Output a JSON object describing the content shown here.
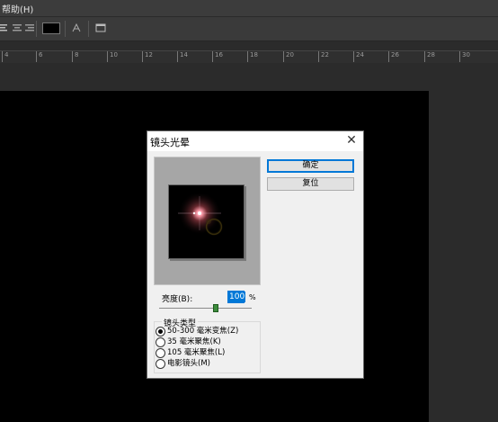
{
  "menu": {
    "help": "帮助(H)"
  },
  "toolbar": {
    "icons": [
      "align-left-icon",
      "align-center-icon",
      "align-right-icon",
      "color-swatch",
      "warp-text-icon",
      "panel-toggle-icon"
    ],
    "swatch_color": "#000000"
  },
  "ruler": {
    "labels": [
      "4",
      "6",
      "8",
      "10",
      "12",
      "14",
      "16",
      "18",
      "20",
      "22",
      "24",
      "26",
      "28",
      "30"
    ]
  },
  "dialog": {
    "title": "镜头光晕",
    "close_symbol": "✕",
    "ok_label": "确定",
    "reset_label": "复位",
    "brightness_label": "亮度(B):",
    "brightness_value": "100",
    "brightness_unit": "%",
    "brightness_fraction": 0.6,
    "lens_group_label": "镜头类型",
    "lens_options": [
      {
        "label": "50-300 毫米变焦(Z)",
        "selected": true
      },
      {
        "label": "35 毫米聚焦(K)",
        "selected": false
      },
      {
        "label": "105 毫米聚焦(L)",
        "selected": false
      },
      {
        "label": "电影镜头(M)",
        "selected": false
      }
    ]
  }
}
